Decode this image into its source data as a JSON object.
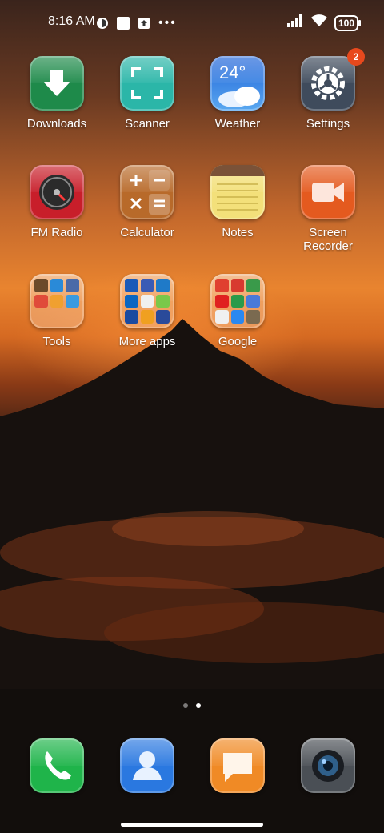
{
  "status_bar": {
    "time": "8:16 AM",
    "battery": "100",
    "icons": [
      "app-status-icon",
      "notification-square-icon",
      "upload-icon",
      "more-dots-icon",
      "signal-icon",
      "wifi-icon",
      "battery-icon"
    ]
  },
  "home": {
    "row1": [
      {
        "label": "Downloads",
        "icon": "download-arrow-icon",
        "color": "#1e8a4a"
      },
      {
        "label": "Scanner",
        "icon": "scan-frame-icon",
        "color": "#2bb6a8"
      },
      {
        "label": "Weather",
        "temperature": "24°",
        "icon": "cloud-icon",
        "color": "#2f7de0"
      },
      {
        "label": "Settings",
        "badge": "2",
        "icon": "gear-icon",
        "color": "#3f4b5c"
      }
    ],
    "row2": [
      {
        "label": "FM Radio",
        "icon": "radio-dial-icon",
        "color": "#c81e2a"
      },
      {
        "label": "Calculator",
        "icon": "calculator-icon",
        "color": "#b86a2a"
      },
      {
        "label": "Notes",
        "icon": "notepad-icon",
        "color": "#f3e07a"
      },
      {
        "label": "Screen\nRecorder",
        "icon": "video-camera-icon",
        "color": "#e45a1f"
      }
    ],
    "folders": [
      {
        "label": "Tools"
      },
      {
        "label": "More apps"
      },
      {
        "label": "Google"
      }
    ]
  },
  "pager": {
    "pages": 2,
    "active_index": 1
  },
  "dock": [
    {
      "name": "phone",
      "icon": "phone-handset-icon",
      "color": "#1fb44a"
    },
    {
      "name": "contacts",
      "icon": "contact-person-icon",
      "color": "#2a78e0"
    },
    {
      "name": "messages",
      "icon": "message-bubble-icon",
      "color": "#f08a25"
    },
    {
      "name": "camera",
      "icon": "camera-lens-icon",
      "color": "#4a4f55"
    }
  ]
}
